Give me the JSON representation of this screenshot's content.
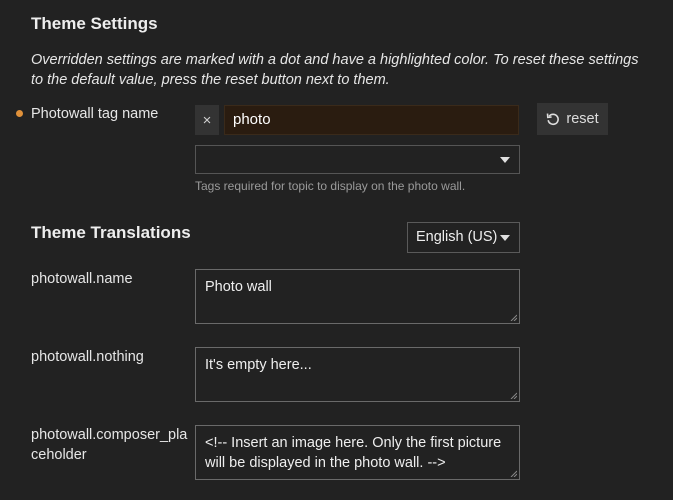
{
  "theme_settings": {
    "heading": "Theme Settings",
    "description": "Overridden settings are marked with a dot and have a highlighted color. To reset these settings to the default value, press the reset button next to them.",
    "photowall_tag": {
      "label": "Photowall tag name",
      "tag_value": "photo",
      "remove_glyph": "×",
      "reset_label": "reset",
      "hint": "Tags required for topic to display on the photo wall."
    }
  },
  "theme_translations": {
    "heading": "Theme Translations",
    "language": "English (US)",
    "fields": [
      {
        "key": "photowall.name",
        "value": "Photo wall"
      },
      {
        "key": "photowall.nothing",
        "value": "It's empty here..."
      },
      {
        "key": "photowall.composer_placeholder",
        "value": "<!-- Insert an image here. Only the first picture will be displayed in the photo wall. -->"
      }
    ]
  },
  "colors": {
    "background": "#222222",
    "override_dot": "#e0913a",
    "overridden_input_bg": "#2a1c10"
  }
}
